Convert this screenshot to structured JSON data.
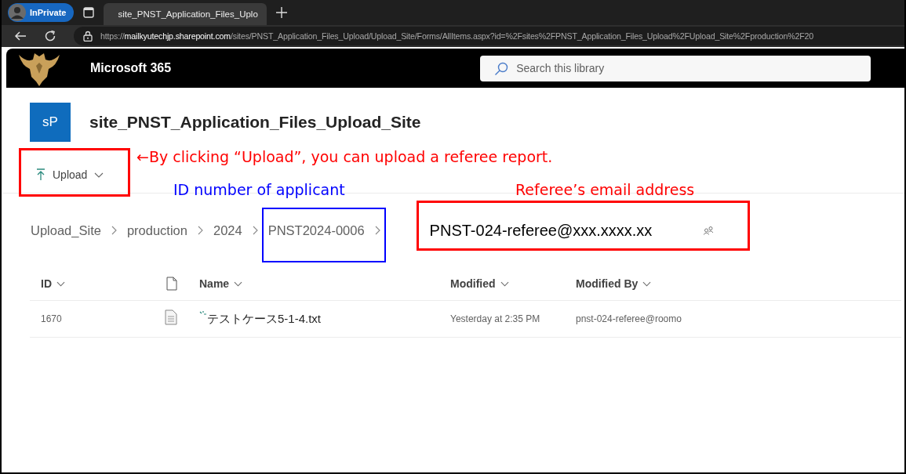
{
  "browser": {
    "profile": "InPrivate",
    "tabs": [
      {
        "title": "site_PNST_Application_Files_Uplo",
        "selected": true
      }
    ],
    "url": {
      "scheme": "https://",
      "host": "mailkyutechjp.sharepoint.com",
      "path": "/sites/PNST_Application_Files_Upload/Upload_Site/Forms/AllItems.aspx?id=%2Fsites%2FPNST_Application_Files_Upload%2FUpload_Site%2Fproduction%2F20"
    }
  },
  "suite_bar": {
    "app_name": "Microsoft 365",
    "search": {
      "placeholder": "Search this library"
    }
  },
  "site": {
    "logo_text": "sP",
    "title": "site_PNST_Application_Files_Upload_Site"
  },
  "command_bar": [
    {
      "label": "Upload"
    }
  ],
  "breadcrumb": [
    {
      "label": "Upload_Site",
      "kind": "link"
    },
    {
      "label": "production",
      "kind": "link"
    },
    {
      "label": "2024",
      "kind": "link"
    },
    {
      "label": "PNST2024-0006",
      "kind": "link"
    },
    {
      "label": "PNST-024-referee@xxx.xxxx.xx",
      "kind": "current"
    }
  ],
  "table": {
    "columns": [
      {
        "kind": "text",
        "label": "ID"
      },
      {
        "kind": "file-type"
      },
      {
        "kind": "text",
        "label": "Name"
      },
      {
        "kind": "text",
        "label": "Modified"
      },
      {
        "kind": "text",
        "label": "Modified By"
      }
    ],
    "rows": [
      {
        "id": "1670",
        "name": "テストケース5-1-4.txt",
        "new": true,
        "modified": "Yesterday at 2:35 PM",
        "modified_by": "pnst-024-referee@roomo"
      }
    ]
  },
  "annotations": [
    {
      "text": "←By clicking “Upload”, you can upload a referee report.",
      "color": "#ff0000"
    },
    {
      "text": "ID number of applicant",
      "color": "#0000ff"
    },
    {
      "text": "Referee’s email address",
      "color": "#ff0000"
    }
  ],
  "highlights": [
    {
      "color": "#ff0000"
    },
    {
      "color": "#0000ff"
    },
    {
      "color": "#ff0000"
    }
  ]
}
